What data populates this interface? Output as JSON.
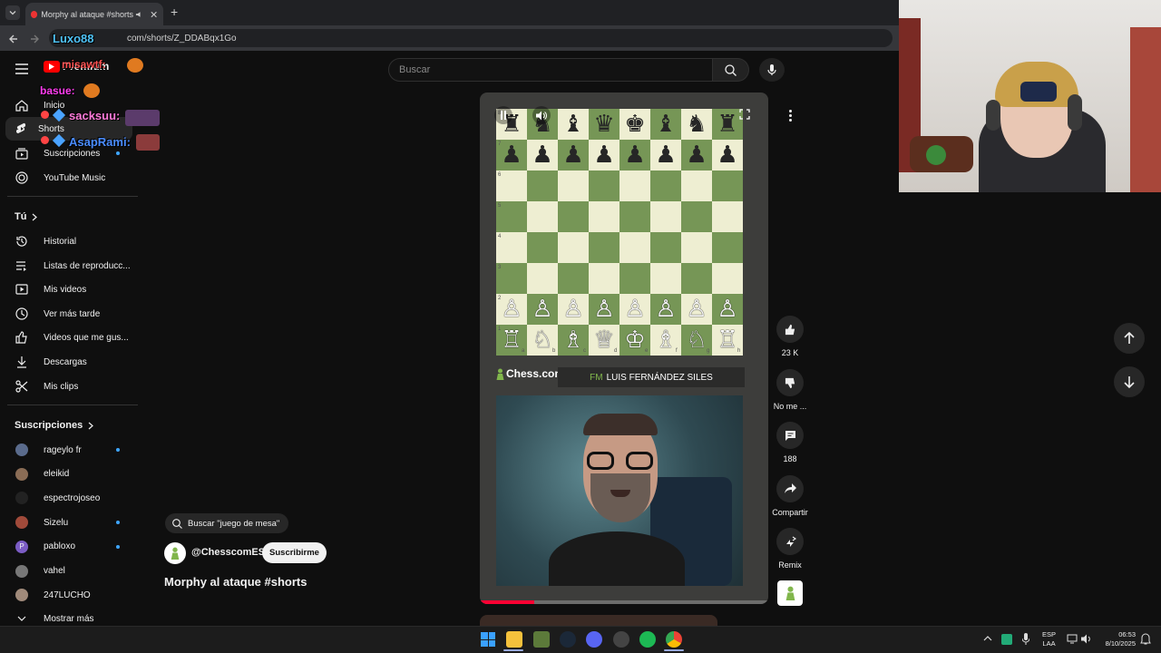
{
  "browser": {
    "tab_title": "Morphy al ataque #shorts",
    "url": "com/shorts/Z_DDABqx1Go",
    "new_tab": "+"
  },
  "search": {
    "placeholder": "Buscar"
  },
  "sidebar": {
    "premium_label": "Premium",
    "main": [
      {
        "label": "Inicio",
        "icon": "home-icon"
      },
      {
        "label": "Shorts",
        "icon": "shorts-icon"
      },
      {
        "label": "Suscripciones",
        "icon": "subscriptions-icon"
      },
      {
        "label": "YouTube Music",
        "icon": "music-icon"
      }
    ],
    "you_title": "Tú",
    "you": [
      {
        "label": "Historial",
        "icon": "history-icon"
      },
      {
        "label": "Listas de reproducc...",
        "icon": "playlist-icon"
      },
      {
        "label": "Mis videos",
        "icon": "my-videos-icon"
      },
      {
        "label": "Ver más tarde",
        "icon": "watch-later-icon"
      },
      {
        "label": "Videos que me gus...",
        "icon": "liked-icon"
      },
      {
        "label": "Descargas",
        "icon": "download-icon"
      },
      {
        "label": "Mis clips",
        "icon": "clips-icon"
      }
    ],
    "subs_title": "Suscripciones",
    "subs": [
      {
        "label": "rageylo fr",
        "dot": true,
        "color": "#5a6b8c"
      },
      {
        "label": "eleikid",
        "dot": false,
        "color": "#8a6c55"
      },
      {
        "label": "espectrojoseo",
        "dot": false,
        "color": "#222222"
      },
      {
        "label": "Sizelu",
        "dot": true,
        "color": "#a04a3a"
      },
      {
        "label": "pabloxo",
        "dot": true,
        "color": "#7b5cc4",
        "letter": "P"
      },
      {
        "label": "vahel",
        "dot": false,
        "color": "#777777"
      },
      {
        "label": "247LUCHO",
        "dot": false,
        "color": "#a08a7a"
      }
    ],
    "more_label": "Mostrar más"
  },
  "chat_overlay": [
    {
      "user": "Luxo88",
      "text": ""
    },
    {
      "user": "misawtf:",
      "text": ""
    },
    {
      "user": "basue:",
      "text": ""
    },
    {
      "user": "sacksuu:",
      "text": ""
    },
    {
      "user": "AsapRami:",
      "text": ""
    }
  ],
  "short": {
    "search_chip": "Buscar \"juego de mesa\"",
    "channel": "@ChesscomES",
    "subscribe": "Suscribirme",
    "title": "Morphy al ataque #shorts",
    "brand": "Chess.com",
    "presenter_title": "FM",
    "presenter_name": "LUIS FERNÁNDEZ SILES",
    "board": {
      "black_back": [
        "♜",
        "♞",
        "♝",
        "♛",
        "♚",
        "♝",
        "♞",
        "♜"
      ],
      "black_pawns": [
        "♟",
        "♟",
        "♟",
        "♟",
        "♟",
        "♟",
        "♟",
        "♟"
      ],
      "white_pawns": [
        "♙",
        "♙",
        "♙",
        "♙",
        "♙",
        "♙",
        "♙",
        "♙"
      ],
      "white_back": [
        "♖",
        "♘",
        "♗",
        "♕",
        "♔",
        "♗",
        "♘",
        "♖"
      ],
      "ranks": [
        "8",
        "7",
        "6",
        "5",
        "4",
        "3",
        "2",
        "1"
      ],
      "files": [
        "a",
        "b",
        "c",
        "d",
        "e",
        "f",
        "g",
        "h"
      ]
    },
    "progress": 0.19
  },
  "actions": {
    "likes": "23 K",
    "dislike": "No me ...",
    "comments": "188",
    "share": "Compartir",
    "remix": "Remix"
  },
  "taskbar": {
    "lang": "ESP",
    "lang_sub": "LAA",
    "time": "06:53",
    "date": "8/10/2025"
  },
  "colors": {
    "board_light": "#eeeed2",
    "board_dark": "#769656",
    "accent_blue": "#3ea6ff",
    "subscribe_bg": "#f1f1f1",
    "progress": "#ff0033"
  }
}
